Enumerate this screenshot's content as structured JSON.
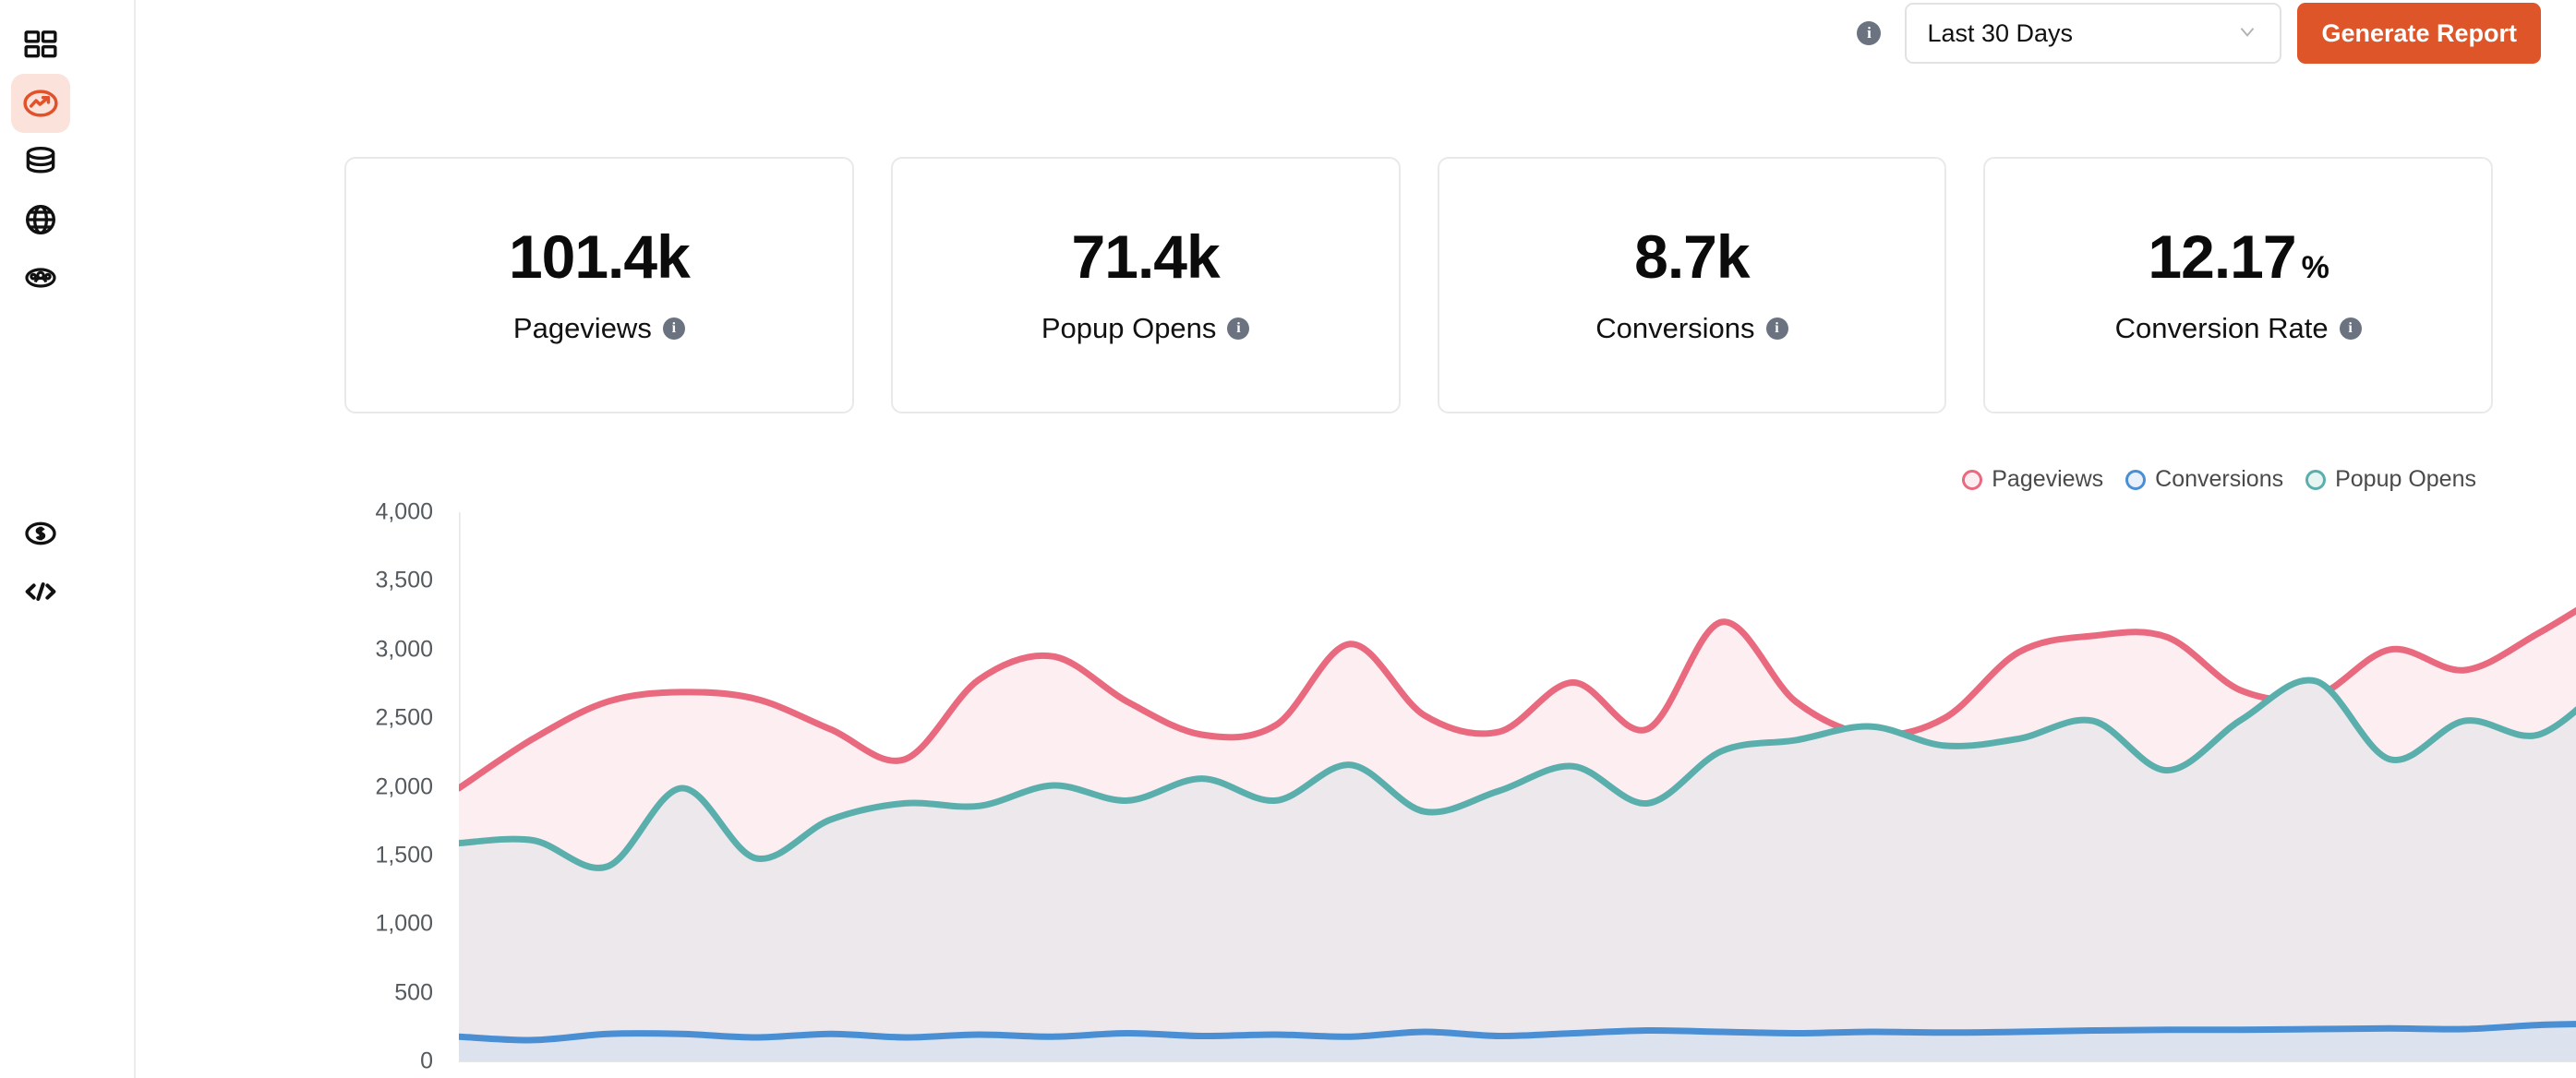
{
  "sidebar": {
    "items": [
      {
        "name": "dashboard-icon",
        "label": "Dashboard",
        "active": false
      },
      {
        "name": "analytics-icon",
        "label": "Analytics",
        "active": true
      },
      {
        "name": "database-icon",
        "label": "Data",
        "active": false
      },
      {
        "name": "globe-icon",
        "label": "Sites",
        "active": false
      },
      {
        "name": "audience-icon",
        "label": "Audience",
        "active": false
      },
      {
        "name": "billing-icon",
        "label": "Billing",
        "active": false
      },
      {
        "name": "code-icon",
        "label": "Developers",
        "active": false
      }
    ]
  },
  "toolbar": {
    "info_icon": "info-icon",
    "info_glyph": "i",
    "date_range_value": "Last 30 Days",
    "date_range_options": [
      "Last 30 Days"
    ],
    "chevron_icon": "chevron-down-icon",
    "generate_report_label": "Generate Report",
    "accent_color": "#dd5529"
  },
  "cards": [
    {
      "value": "101.4k",
      "unit": "",
      "label": "Pageviews",
      "info": "i"
    },
    {
      "value": "71.4k",
      "unit": "",
      "label": "Popup Opens",
      "info": "i"
    },
    {
      "value": "8.7k",
      "unit": "",
      "label": "Conversions",
      "info": "i"
    },
    {
      "value": "12.17",
      "unit": "%",
      "label": "Conversion Rate",
      "info": "i"
    }
  ],
  "chart_data": {
    "type": "area",
    "title": "",
    "xlabel": "",
    "ylabel": "",
    "ylim": [
      0,
      4000
    ],
    "yticks": [
      4000,
      3500,
      3000,
      2500,
      2000,
      1500,
      1000,
      500,
      0
    ],
    "ytick_labels": [
      "4,000",
      "3,500",
      "3,000",
      "2,500",
      "2,000",
      "1,500",
      "1,000",
      "500",
      "0"
    ],
    "grid": false,
    "legend_position": "top-right",
    "x": [
      1,
      2,
      3,
      4,
      5,
      6,
      7,
      8,
      9,
      10,
      11,
      12,
      13,
      14,
      15,
      16,
      17,
      18,
      19,
      20,
      21,
      22,
      23,
      24,
      25,
      26,
      27,
      28,
      29,
      30
    ],
    "series": [
      {
        "name": "Pageviews",
        "color": "#e9697f",
        "fill": "#fdeef1",
        "values": [
          1990,
          2350,
          2620,
          2690,
          2640,
          2420,
          2200,
          2780,
          2950,
          2620,
          2380,
          2450,
          3040,
          2520,
          2400,
          2760,
          2420,
          3200,
          2620,
          2380,
          2500,
          2980,
          3100,
          3090,
          2700,
          2660,
          3000,
          2850,
          3120,
          3450
        ]
      },
      {
        "name": "Popup Opens",
        "color": "#5aafad",
        "fill": "#ece8ec",
        "values": [
          1590,
          1610,
          1420,
          1990,
          1480,
          1760,
          1880,
          1860,
          2010,
          1900,
          2060,
          1900,
          2160,
          1820,
          1970,
          2150,
          1880,
          2260,
          2340,
          2440,
          2300,
          2350,
          2480,
          2120,
          2490,
          2770,
          2200,
          2480,
          2380,
          2800
        ]
      },
      {
        "name": "Conversions",
        "color": "#4a8fd4",
        "fill": "#dde3ee",
        "values": [
          180,
          155,
          200,
          200,
          175,
          200,
          175,
          195,
          180,
          205,
          185,
          195,
          180,
          215,
          185,
          205,
          225,
          215,
          205,
          215,
          210,
          215,
          225,
          230,
          230,
          235,
          240,
          235,
          265,
          275
        ]
      }
    ],
    "legend": [
      {
        "label": "Pageviews",
        "color": "#e9697f",
        "fill": "#fdeef1"
      },
      {
        "label": "Conversions",
        "color": "#4a8fd4",
        "fill": "#e8f0fb"
      },
      {
        "label": "Popup Opens",
        "color": "#5aafad",
        "fill": "#e6f4f2"
      }
    ]
  }
}
